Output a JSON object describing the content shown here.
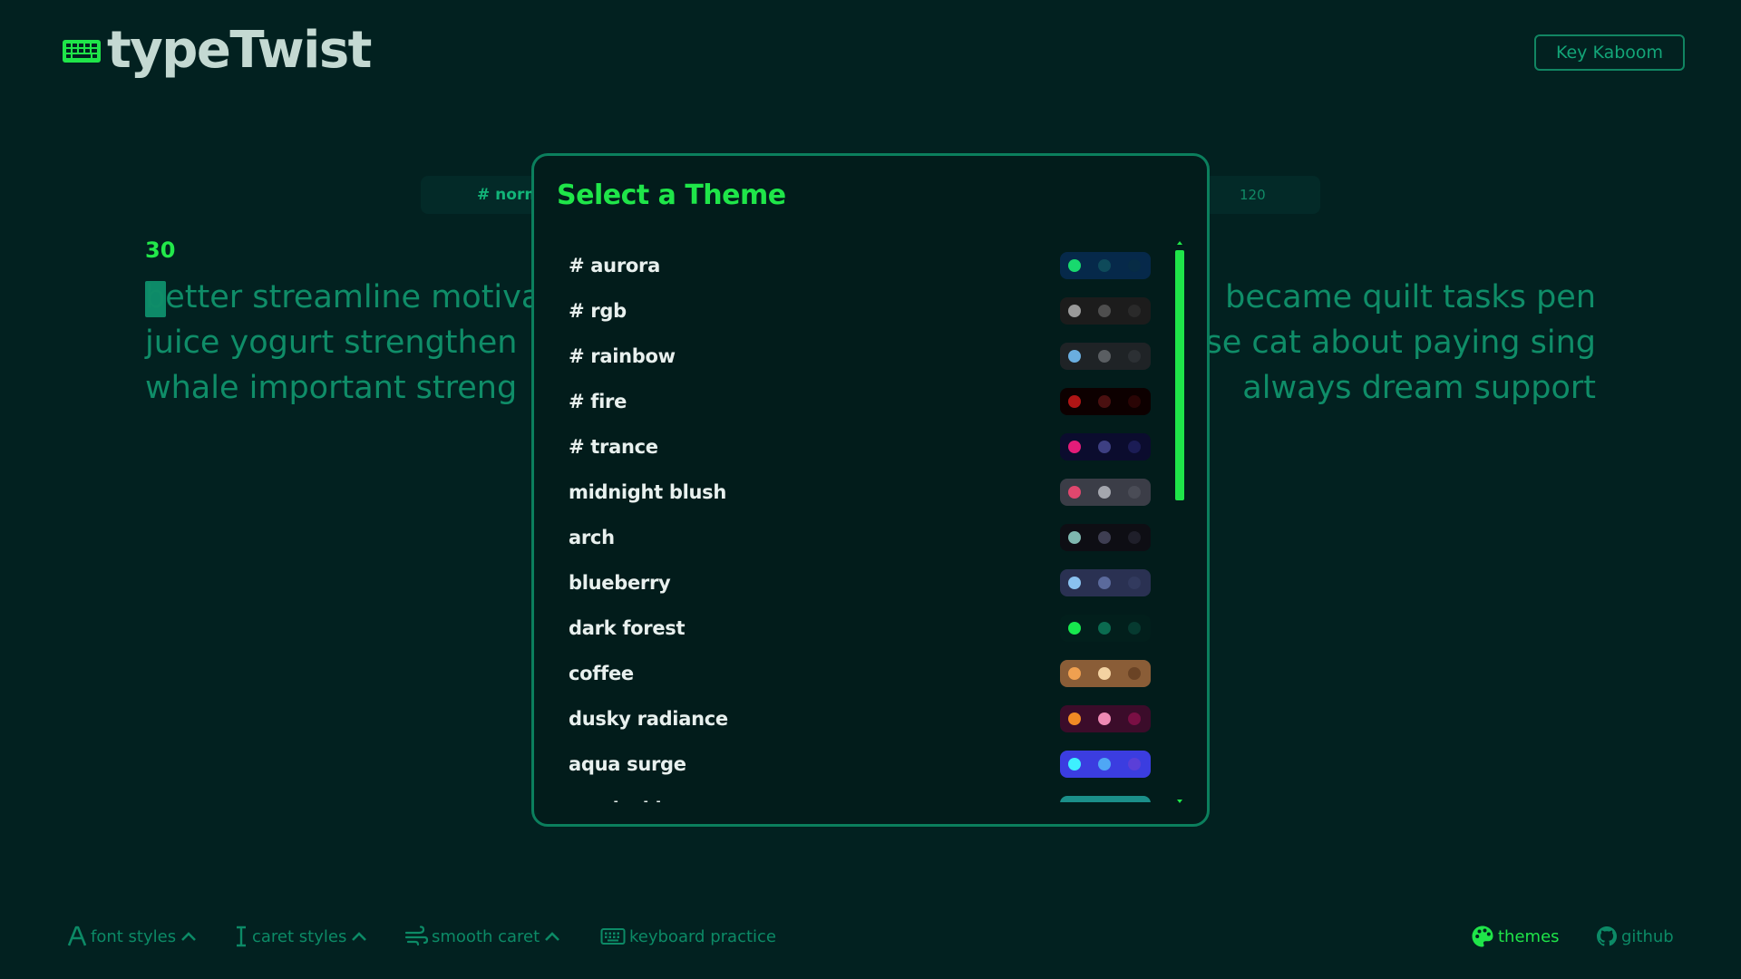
{
  "header": {
    "logo_text": "typeTwist",
    "brand_button": "Key Kaboom"
  },
  "settings_bar": {
    "mode": "# norm",
    "count": "120"
  },
  "typing": {
    "timer": "30",
    "lines_left": [
      "better streamline motiva",
      "juice yogurt strengthen",
      "whale important streng"
    ],
    "lines_right": [
      "became quilt tasks pen",
      "se cat about paying sing",
      "always dream support"
    ]
  },
  "modal": {
    "title": "Select a Theme",
    "themes": [
      {
        "name": "# aurora",
        "bg": "#06294a",
        "c1": "#18d96e",
        "c2": "#0e4a5a",
        "c3": "#072c45"
      },
      {
        "name": "# rgb",
        "bg": "#1c1c1c",
        "c1": "#9a9a9a",
        "c2": "#4e4e4e",
        "c3": "#2a2a2a"
      },
      {
        "name": "# rainbow",
        "bg": "#1f2326",
        "c1": "#6aaee0",
        "c2": "#5a5e62",
        "c3": "#2c3034"
      },
      {
        "name": "# fire",
        "bg": "#0d0000",
        "c1": "#b01515",
        "c2": "#4a1010",
        "c3": "#2a0505"
      },
      {
        "name": "# trance",
        "bg": "#0b0c2e",
        "c1": "#e31c79",
        "c2": "#3d3f82",
        "c3": "#1b1c55"
      },
      {
        "name": "midnight blush",
        "bg": "#3b3d47",
        "c1": "#e0476e",
        "c2": "#a4a6ae",
        "c3": "#4a4c56"
      },
      {
        "name": "arch",
        "bg": "#0e0e14",
        "c1": "#7fb8b0",
        "c2": "#3e3e52",
        "c3": "#1f1f2a"
      },
      {
        "name": "blueberry",
        "bg": "#2a3152",
        "c1": "#8ac2f0",
        "c2": "#5b6a9c",
        "c3": "#323a5e"
      },
      {
        "name": "dark forest",
        "bg": "#021f1c",
        "c1": "#17e84e",
        "c2": "#0b6b50",
        "c3": "#063a30"
      },
      {
        "name": "coffee",
        "bg": "#8a5d37",
        "c1": "#f0a050",
        "c2": "#f3d2a2",
        "c3": "#6a4325"
      },
      {
        "name": "dusky radiance",
        "bg": "#3b0c2a",
        "c1": "#f08a24",
        "c2": "#ef8ab4",
        "c3": "#7a0f44"
      },
      {
        "name": "aqua surge",
        "bg": "#3b3de0",
        "c1": "#3ef0ff",
        "c2": "#4fa7f5",
        "c3": "#5a3fd8"
      },
      {
        "name": "tropical breeze",
        "bg": "#1b8f8a",
        "c1": "#f6e441",
        "c2": "#8ae07a",
        "c3": "#0d5f61"
      }
    ]
  },
  "footer": {
    "font_styles": "font styles",
    "caret_styles": "caret styles",
    "smooth_caret": "smooth caret",
    "keyboard_practice": "keyboard practice",
    "themes": "themes",
    "github": "github"
  }
}
